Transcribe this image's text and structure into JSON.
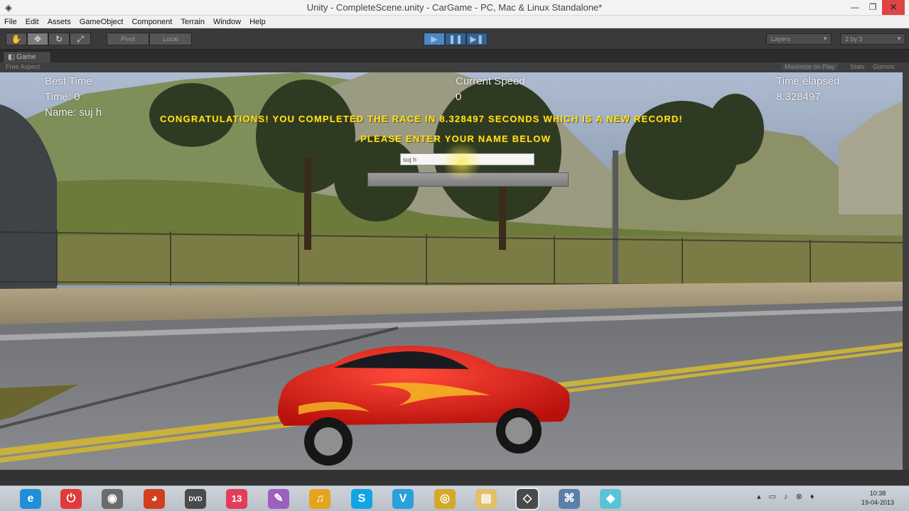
{
  "window": {
    "title": "Unity - CompleteScene.unity - CarGame - PC, Mac & Linux Standalone*",
    "min_icon": "minimize-icon",
    "max_icon": "maximize-icon",
    "close_icon": "close-icon"
  },
  "menu": {
    "items": [
      "File",
      "Edit",
      "Assets",
      "GameObject",
      "Component",
      "Terrain",
      "Window",
      "Help"
    ]
  },
  "toolbar": {
    "tools": [
      {
        "icon": "hand-tool-icon",
        "glyph": "✋"
      },
      {
        "icon": "move-tool-icon",
        "glyph": "✥"
      },
      {
        "icon": "rotate-tool-icon",
        "glyph": "↻"
      },
      {
        "icon": "scale-tool-icon",
        "glyph": "⤢"
      }
    ],
    "pivot_label": "Pivot",
    "local_label": "Local",
    "play": {
      "icon": "play-icon",
      "glyph": "▶"
    },
    "pause": {
      "icon": "pause-icon",
      "glyph": "❚❚"
    },
    "step": {
      "icon": "step-icon",
      "glyph": "▶❚"
    },
    "layers_label": "Layers",
    "layout_label": "2 by 3"
  },
  "game_panel": {
    "tab_label": "Game",
    "aspect_label": "Free Aspect",
    "maximize_label": "Maximize on Play",
    "stats_label": "Stats",
    "gizmos_label": "Gizmos"
  },
  "hud": {
    "best_time_label": "Best Time",
    "best_time_value": "Time: 0",
    "best_name": "Name: suj h",
    "speed_label": "Current Speed",
    "speed_value": "0",
    "elapsed_label": "Time elapsed",
    "elapsed_value": "8.328497"
  },
  "race_message": {
    "congrats": "CONGRATULATIONS! YOU COMPLETED THE RACE IN 8.328497 SECONDS WHICH IS A NEW RECORD!",
    "prompt": "PLEASE ENTER YOUR NAME BELOW",
    "name_value": "suj h"
  },
  "taskbar": {
    "icons": [
      {
        "name": "internet-explorer-icon",
        "glyph": "e",
        "color": "#1e8fd8"
      },
      {
        "name": "power-app-icon",
        "glyph": "⏻",
        "color": "#e03a3a"
      },
      {
        "name": "webcam-icon",
        "glyph": "◉",
        "color": "#6b6b6b"
      },
      {
        "name": "media-disc-icon",
        "glyph": "◕",
        "color": "#d04020"
      },
      {
        "name": "dvd-icon",
        "glyph": "DVD",
        "color": "#4a4a4a"
      },
      {
        "name": "app-13-icon",
        "glyph": "13",
        "color": "#e23d5b"
      },
      {
        "name": "paint-icon",
        "glyph": "✎",
        "color": "#9b5fc0"
      },
      {
        "name": "headphones-icon",
        "glyph": "♫",
        "color": "#e6a31e"
      },
      {
        "name": "skype-icon",
        "glyph": "S",
        "color": "#12a5e6"
      },
      {
        "name": "vector-app-icon",
        "glyph": "V",
        "color": "#2aa0dc"
      },
      {
        "name": "chrome-icon",
        "glyph": "◎",
        "color": "#d5a82a"
      },
      {
        "name": "file-explorer-icon",
        "glyph": "▤",
        "color": "#e1c06a"
      },
      {
        "name": "unity-icon",
        "glyph": "◇",
        "color": "#4a4a4a"
      },
      {
        "name": "network-app-icon",
        "glyph": "⌘",
        "color": "#5b7fa8"
      },
      {
        "name": "notes-icon",
        "glyph": "◆",
        "color": "#5ac3d8"
      }
    ],
    "tray_glyphs": "▴ ▭ ♪ ⊗ ♦",
    "time": "10:38",
    "date": "19-04-2013"
  }
}
